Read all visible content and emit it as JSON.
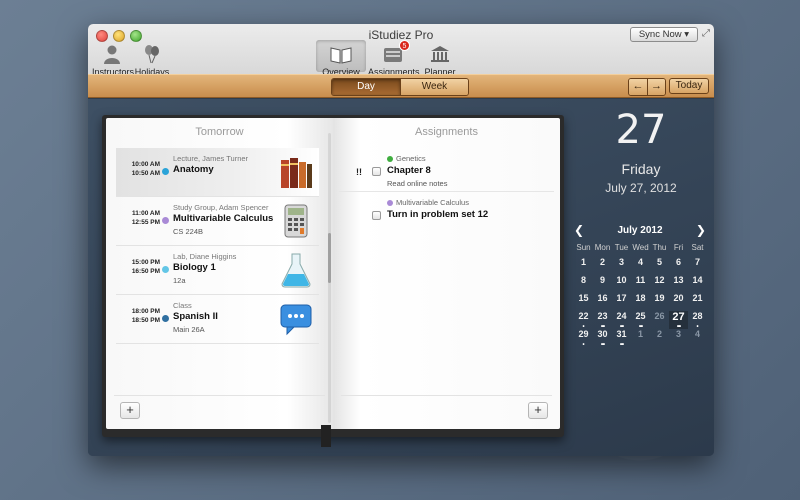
{
  "window": {
    "title": "iStudiez Pro",
    "sync_label": "Sync Now ▾"
  },
  "toolbar": {
    "instructors": "Instructors",
    "holidays": "Holidays",
    "overview": "Overview",
    "assignments": "Assignments",
    "assignments_badge": "5",
    "planner": "Planner"
  },
  "viewbar": {
    "day": "Day",
    "week": "Week",
    "prev": "←",
    "next": "→",
    "today": "Today"
  },
  "left_page": {
    "title": "Tomorrow",
    "events": [
      {
        "start": "10:00 AM",
        "end": "10:50 AM",
        "sub": "Lecture, James Turner",
        "name": "Anatomy",
        "room": "",
        "color": "#2aa3d8",
        "icon": "books-icon"
      },
      {
        "start": "11:00 AM",
        "end": "12:55 PM",
        "sub": "Study Group, Adam Spencer",
        "name": "Multivariable Calculus",
        "room": "CS 224B",
        "color": "#a98ad6",
        "icon": "calculator-icon"
      },
      {
        "start": "15:00 PM",
        "end": "16:50 PM",
        "sub": "Lab, Diane Higgins",
        "name": "Biology 1",
        "room": "12a",
        "color": "#63c6e6",
        "icon": "flask-icon"
      },
      {
        "start": "18:00 PM",
        "end": "18:50 PM",
        "sub": "Class",
        "name": "Spanish II",
        "room": "Main 26A",
        "color": "#2f6fa0",
        "icon": "speech-bubble-icon"
      }
    ],
    "add": "+"
  },
  "right_page": {
    "title": "Assignments",
    "items": [
      {
        "course": "Genetics",
        "course_color": "#3fae3f",
        "priority": "!!",
        "title": "Chapter 8",
        "note": "Read online notes"
      },
      {
        "course": "Multivariable Calculus",
        "course_color": "#a98ad6",
        "priority": "",
        "title": "Turn in problem set 12",
        "note": ""
      }
    ],
    "add": "+"
  },
  "sidebar": {
    "day_number": "27",
    "weekday": "Friday",
    "full_date": "July 27, 2012",
    "calendar": {
      "month": "July 2012",
      "prev": "❮",
      "next": "❯",
      "dow": [
        "Sun",
        "Mon",
        "Tue",
        "Wed",
        "Thu",
        "Fri",
        "Sat"
      ],
      "weeks": [
        [
          "1",
          "2",
          "3",
          "4",
          "5",
          "6",
          "7"
        ],
        [
          "8",
          "9",
          "10",
          "11",
          "12",
          "13",
          "14"
        ],
        [
          "15",
          "16",
          "17",
          "18",
          "19",
          "20",
          "21"
        ],
        [
          "22",
          "23",
          "24",
          "25",
          "26",
          "27",
          "28"
        ],
        [
          "29",
          "30",
          "31",
          "1",
          "2",
          "3",
          "4"
        ]
      ]
    }
  }
}
